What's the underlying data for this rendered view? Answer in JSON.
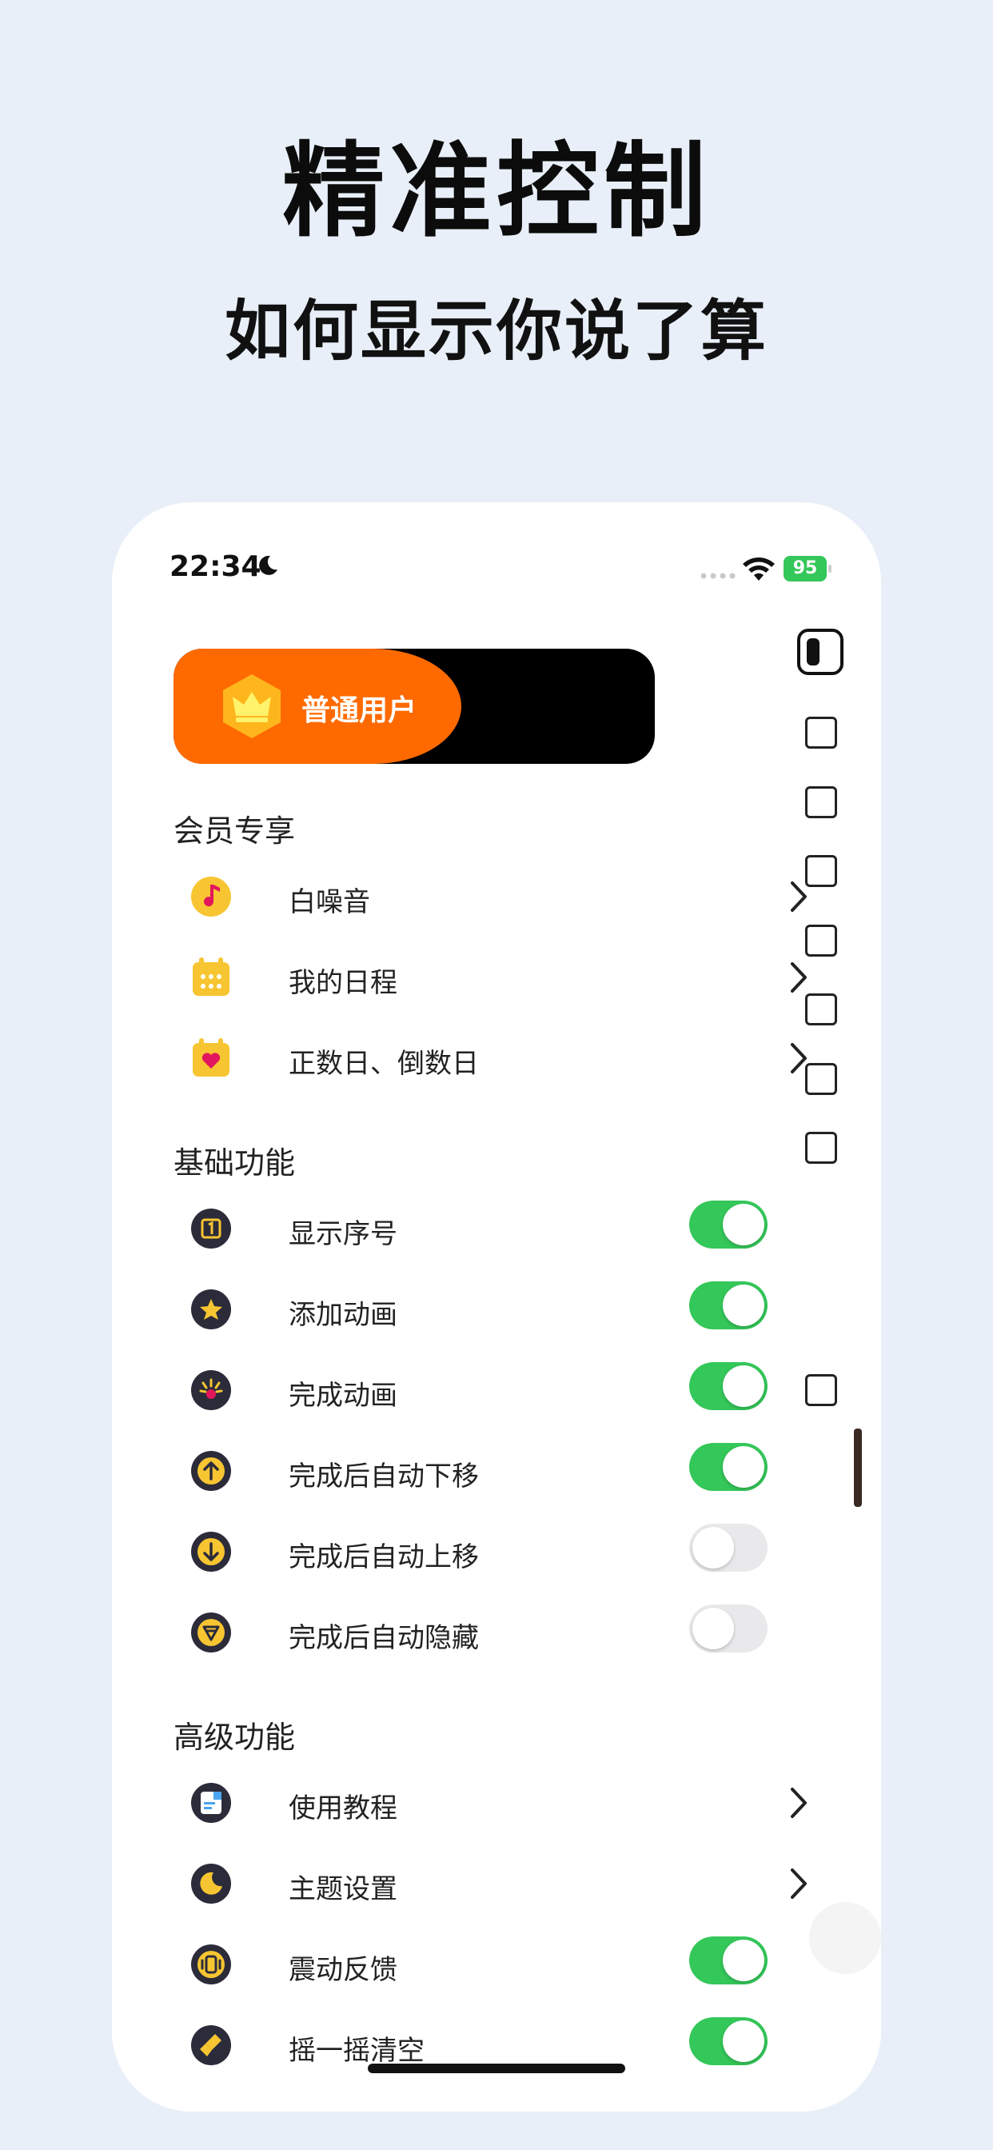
{
  "hero": {
    "title": "精准控制",
    "subtitle": "如何显示你说了算"
  },
  "status_bar": {
    "time": "22:34",
    "battery": "95"
  },
  "user_card": {
    "label": "普通用户"
  },
  "sections": {
    "member": {
      "title": "会员专享",
      "items": [
        {
          "label": "白噪音",
          "icon": "music-note-icon"
        },
        {
          "label": "我的日程",
          "icon": "calendar-icon"
        },
        {
          "label": "正数日、倒数日",
          "icon": "heart-calendar-icon"
        }
      ]
    },
    "basic": {
      "title": "基础功能",
      "items": [
        {
          "label": "显示序号",
          "icon": "number-icon",
          "on": true
        },
        {
          "label": "添加动画",
          "icon": "star-icon",
          "on": true
        },
        {
          "label": "完成动画",
          "icon": "sparkle-icon",
          "on": true
        },
        {
          "label": "完成后自动下移",
          "icon": "arrow-up-icon",
          "on": true
        },
        {
          "label": "完成后自动上移",
          "icon": "arrow-down-icon",
          "on": false
        },
        {
          "label": "完成后自动隐藏",
          "icon": "hide-icon",
          "on": false
        }
      ]
    },
    "advanced": {
      "title": "高级功能",
      "items": [
        {
          "label": "使用教程",
          "icon": "tutorial-icon"
        },
        {
          "label": "主题设置",
          "icon": "theme-icon"
        },
        {
          "label": "震动反馈",
          "icon": "vibration-icon",
          "on": true
        },
        {
          "label": "摇一摇清空",
          "icon": "shake-clear-icon",
          "on": true
        }
      ]
    }
  },
  "colors": {
    "accent_orange": "#ff6a00",
    "toggle_on": "#34c759",
    "toggle_off": "#e9e9eb",
    "icon_gold": "#f7c531",
    "background": "#e8eff8"
  }
}
